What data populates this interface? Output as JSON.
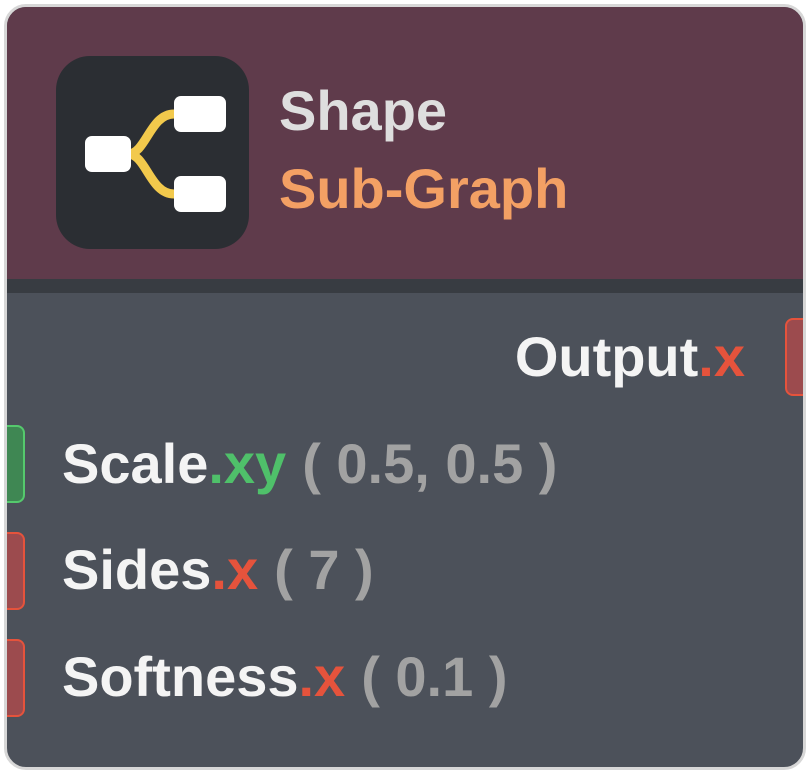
{
  "node": {
    "title": "Shape",
    "subtitle": "Sub-Graph",
    "icon": "subgraph-icon",
    "colors": {
      "header": "#5f3b4b",
      "body": "#4c515a",
      "separator": "#383c42",
      "border": "#d7d7d7",
      "title": "#dedede",
      "subtitle": "#f3a064",
      "icon_background": "#2b2e33",
      "icon_nodes": "#ffffff",
      "icon_links": "#f2c94c"
    }
  },
  "ports": {
    "output": {
      "name": "Output",
      "type": ".x",
      "type_color": "#e5533c",
      "connector_fill": "#9c4b4e",
      "connector_border": "#e5533c"
    },
    "inputs": [
      {
        "name": "Scale",
        "type": ".xy",
        "value": "( 0.5, 0.5 )",
        "type_color": "#4fc06a",
        "connector_fill": "#3f8753",
        "connector_border": "#55c96d"
      },
      {
        "name": "Sides",
        "type": ".x",
        "value": "( 7 )",
        "type_color": "#e5533c",
        "connector_fill": "#9c4b4e",
        "connector_border": "#e5533c"
      },
      {
        "name": "Softness",
        "type": ".x",
        "value": "( 0.1 )",
        "type_color": "#e5533c",
        "connector_fill": "#9c4b4e",
        "connector_border": "#e5533c"
      }
    ]
  }
}
